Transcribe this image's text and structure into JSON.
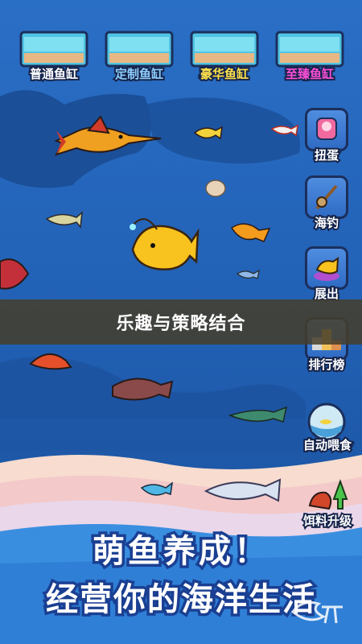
{
  "tanks": [
    {
      "label": "普通鱼缸",
      "color": "#ffffff"
    },
    {
      "label": "定制鱼缸",
      "color": "#8fd0ff"
    },
    {
      "label": "豪华鱼缸",
      "color": "#ffe34a"
    },
    {
      "label": "至臻鱼缸",
      "color": "#ff4fd8"
    }
  ],
  "side_menu": [
    {
      "label": "扭蛋",
      "icon": "gacha-machine-icon"
    },
    {
      "label": "海钓",
      "icon": "fishing-rod-icon"
    },
    {
      "label": "展出",
      "icon": "anglerfish-exhibit-icon"
    },
    {
      "label": "排行榜",
      "icon": "podium-icon"
    },
    {
      "label": "自动喂食",
      "icon": "fishbowl-feeder-icon"
    },
    {
      "label": "饵料升级",
      "icon": "bait-upgrade-icon"
    }
  ],
  "banner": {
    "text": "乐趣与策略结合"
  },
  "slogan": {
    "line1": "萌鱼养成！",
    "line2": "经营你的海洋生活"
  },
  "colors": {
    "sea": "#1f5fb3",
    "sand": "#f6d6c6",
    "banner": "#463e2a"
  }
}
